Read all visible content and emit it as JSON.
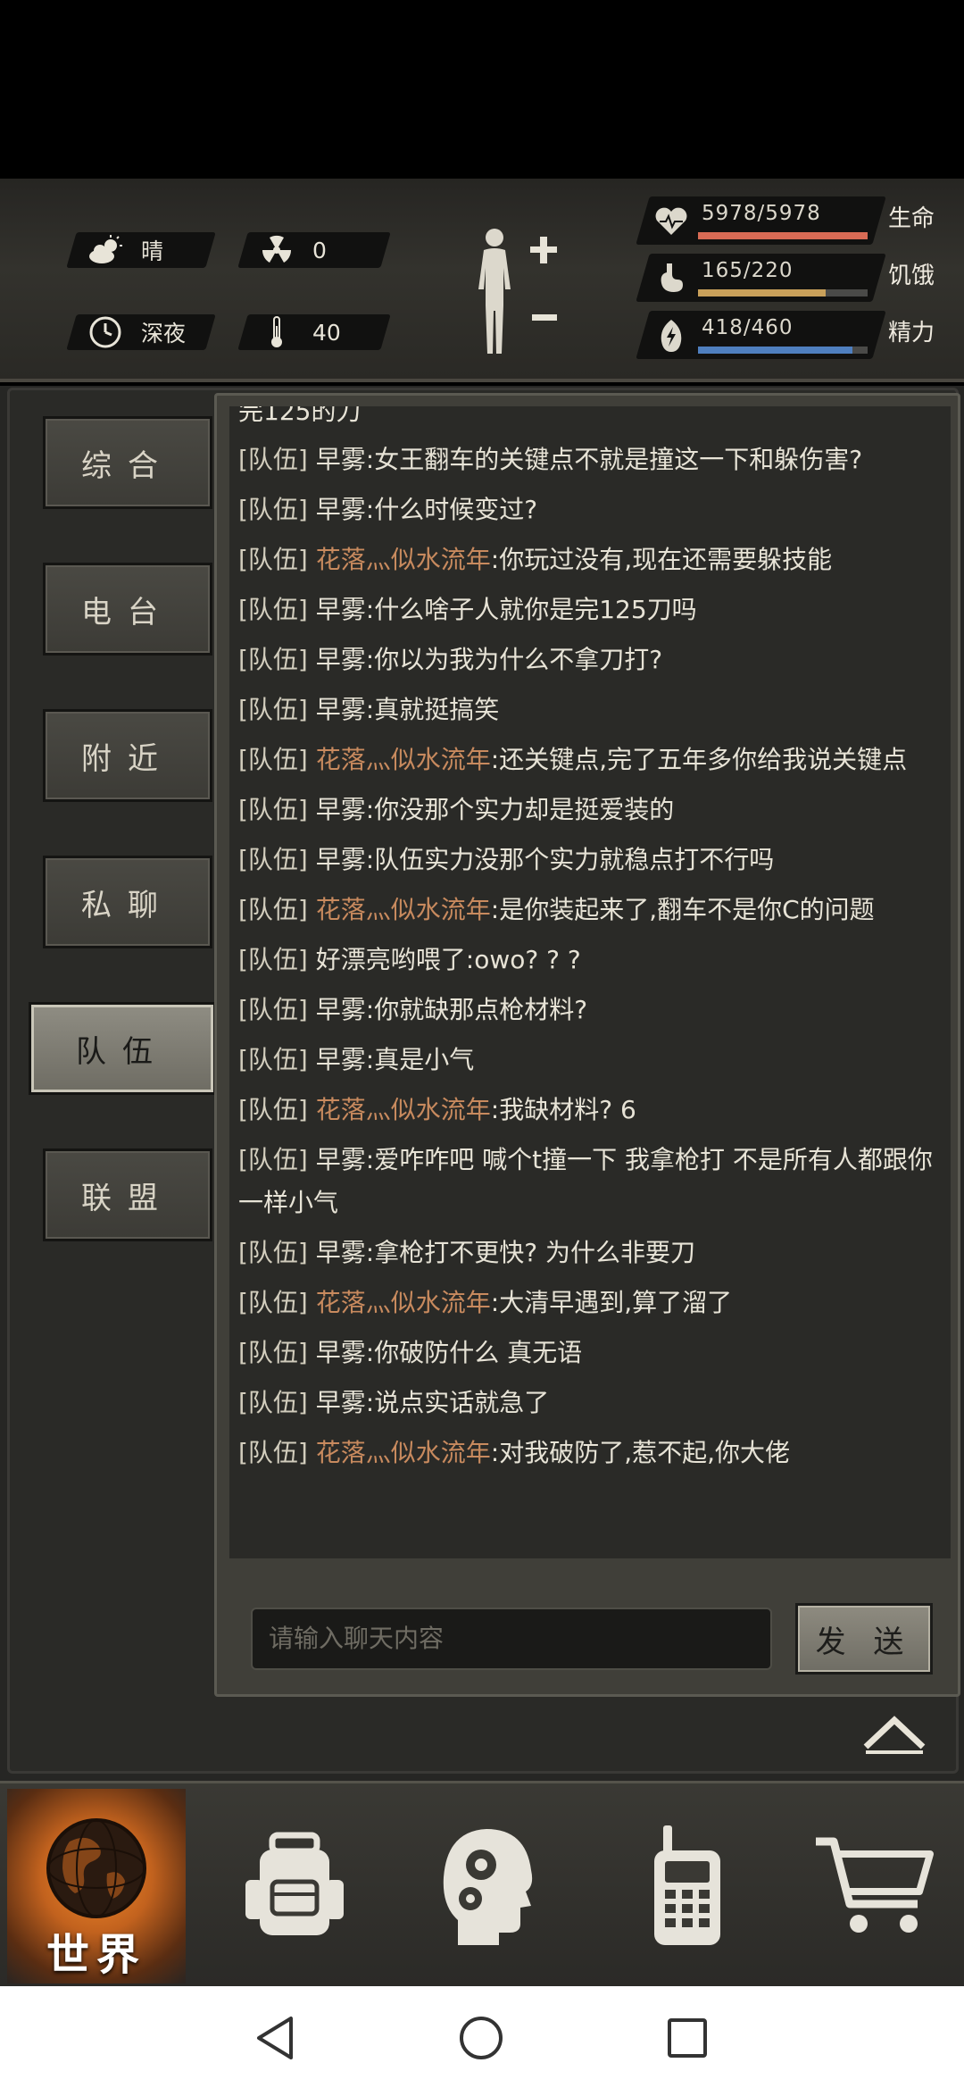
{
  "status": {
    "weather": {
      "icon": "cloud-sun-icon",
      "value": "晴"
    },
    "radiation": {
      "icon": "radiation-icon",
      "value": "0"
    },
    "time": {
      "icon": "clock-icon",
      "value": "深夜"
    },
    "temperature": {
      "icon": "thermometer-icon",
      "value": "40"
    },
    "vitals": [
      {
        "icon": "heart-icon",
        "value": "5978/5978",
        "label": "生命",
        "fraction": 1.0,
        "color": "#d86b55"
      },
      {
        "icon": "stomach-icon",
        "value": "165/220",
        "label": "饥饿",
        "fraction": 0.75,
        "color": "#c9a05a"
      },
      {
        "icon": "energy-icon",
        "value": "418/460",
        "label": "精力",
        "fraction": 0.91,
        "color": "#4f7fbf"
      }
    ]
  },
  "tabs": [
    {
      "label": "综合",
      "active": false
    },
    {
      "label": "电台",
      "active": false
    },
    {
      "label": "附近",
      "active": false
    },
    {
      "label": "私聊",
      "active": false
    },
    {
      "label": "队伍",
      "active": true
    },
    {
      "label": "联盟",
      "active": false
    }
  ],
  "chat": {
    "partial_top": "完125的刀",
    "messages": [
      {
        "channel": "[队伍]",
        "sender": "早雾",
        "text": ":女王翻车的关键点不就是撞这一下和躲伤害?"
      },
      {
        "channel": "[队伍]",
        "sender": "早雾",
        "text": ":什么时候变过?"
      },
      {
        "channel": "[队伍]",
        "sender": "花落灬似水流年",
        "text": ":你玩过没有,现在还需要躲技能"
      },
      {
        "channel": "[队伍]",
        "sender": "早雾",
        "text": ":什么啥子人就你是完125刀吗"
      },
      {
        "channel": "[队伍]",
        "sender": "早雾",
        "text": ":你以为我为什么不拿刀打?"
      },
      {
        "channel": "[队伍]",
        "sender": "早雾",
        "text": ":真就挺搞笑"
      },
      {
        "channel": "[队伍]",
        "sender": "花落灬似水流年",
        "text": ":还关键点,完了五年多你给我说关键点"
      },
      {
        "channel": "[队伍]",
        "sender": "早雾",
        "text": ":你没那个实力却是挺爱装的"
      },
      {
        "channel": "[队伍]",
        "sender": "早雾",
        "text": ":队伍实力没那个实力就稳点打不行吗"
      },
      {
        "channel": "[队伍]",
        "sender": "花落灬似水流年",
        "text": ":是你装起来了,翻车不是你C的问题"
      },
      {
        "channel": "[队伍]",
        "sender": "好漂亮哟",
        "text": "喂了:owo? ? ?"
      },
      {
        "channel": "[队伍]",
        "sender": "早雾",
        "text": ":你就缺那点枪材料?"
      },
      {
        "channel": "[队伍]",
        "sender": "早雾",
        "text": ":真是小气"
      },
      {
        "channel": "[队伍]",
        "sender": "花落灬似水流年",
        "text": ":我缺材料? 6"
      },
      {
        "channel": "[队伍]",
        "sender": "早雾",
        "text": ":爱咋咋吧 喊个t撞一下 我拿枪打 不是所有人都跟你一样小气"
      },
      {
        "channel": "[队伍]",
        "sender": "早雾",
        "text": ":拿枪打不更快? 为什么非要刀"
      },
      {
        "channel": "[队伍]",
        "sender": "花落灬似水流年",
        "text": ":大清早遇到,算了溜了"
      },
      {
        "channel": "[队伍]",
        "sender": "早雾",
        "text": ":你破防什么 真无语"
      },
      {
        "channel": "[队伍]",
        "sender": "早雾",
        "text": ":说点实话就急了"
      },
      {
        "channel": "[队伍]",
        "sender": "花落灬似水流年",
        "text": ":对我破防了,惹不起,你大佬"
      }
    ],
    "input_placeholder": "请输入聊天内容",
    "send_label": "发 送"
  },
  "nav": {
    "world_label": "世界",
    "items": [
      "globe-icon",
      "backpack-icon",
      "skills-head-icon",
      "walkie-talkie-icon",
      "shopping-cart-icon"
    ]
  },
  "colors": {
    "accent_orange": "#c88a5e",
    "world_glow": "#f28a2a"
  }
}
